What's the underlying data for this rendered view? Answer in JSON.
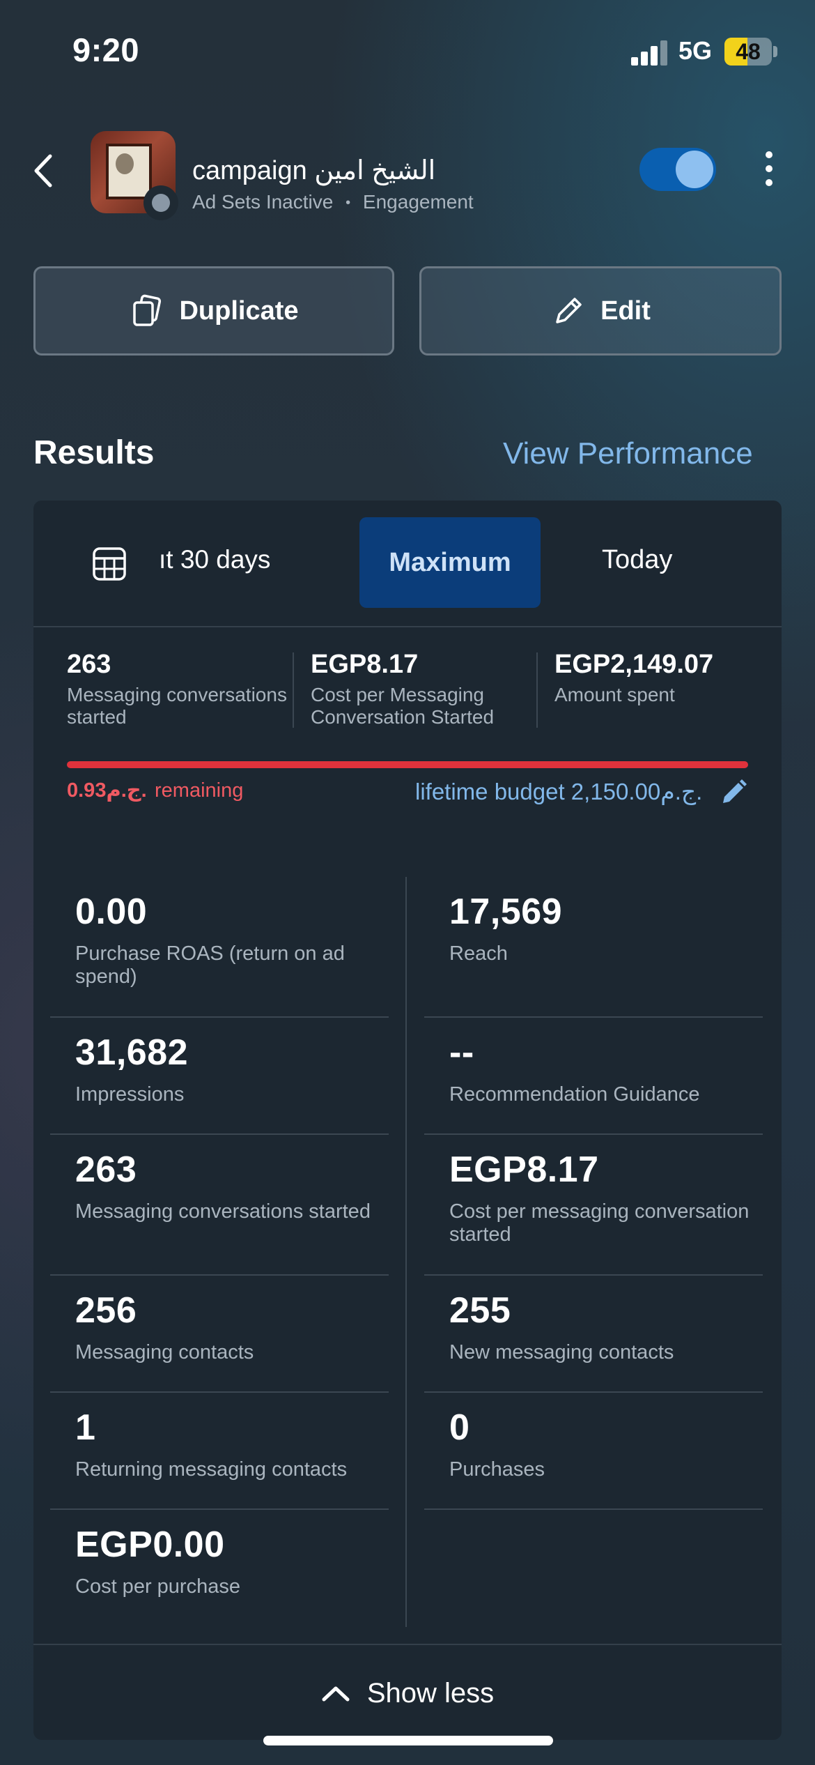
{
  "status": {
    "time": "9:20",
    "network": "5G",
    "battery": "48",
    "battery_level": 0.48
  },
  "header": {
    "title": "campaign الشيخ امين",
    "status": "Ad Sets Inactive",
    "separator": "•",
    "objective": "Engagement",
    "toggle_on": true
  },
  "actions": {
    "duplicate": "Duplicate",
    "edit": "Edit"
  },
  "results": {
    "title": "Results",
    "view_performance": "View Performance",
    "tabs": {
      "last30": "ıt 30 days",
      "maximum": "Maximum",
      "today": "Today",
      "selected": "Maximum"
    },
    "summary": [
      {
        "value": "263",
        "label": "Messaging conversations started"
      },
      {
        "value": "EGP8.17",
        "label": "Cost per Messaging Conversation Started"
      },
      {
        "value": "EGP2,149.07",
        "label": "Amount spent"
      }
    ],
    "budget": {
      "remaining_amount": "0.93ج.م.",
      "remaining_label": "remaining",
      "lifetime_label": "lifetime budget 2,150.00ج.م.",
      "spent_fraction": 0.9996
    },
    "metrics_left": [
      {
        "value": "0.00",
        "label": "Purchase ROAS (return on ad spend)"
      },
      {
        "value": "31,682",
        "label": "Impressions"
      },
      {
        "value": "263",
        "label": "Messaging conversations started"
      },
      {
        "value": "256",
        "label": "Messaging contacts"
      },
      {
        "value": "1",
        "label": "Returning messaging contacts"
      },
      {
        "value": "EGP0.00",
        "label": "Cost per purchase"
      }
    ],
    "metrics_right": [
      {
        "value": "17,569",
        "label": "Reach"
      },
      {
        "value": "--",
        "label": "Recommendation Guidance"
      },
      {
        "value": "EGP8.17",
        "label": "Cost per messaging conversation started"
      },
      {
        "value": "255",
        "label": "New messaging contacts"
      },
      {
        "value": "0",
        "label": "Purchases"
      }
    ],
    "show_less": "Show less"
  },
  "colors": {
    "accent_link": "#82b8ea",
    "toggle": "#0a5fb0",
    "budget_bar": "#e0323c",
    "tab_selected": "#0b3d7a"
  }
}
